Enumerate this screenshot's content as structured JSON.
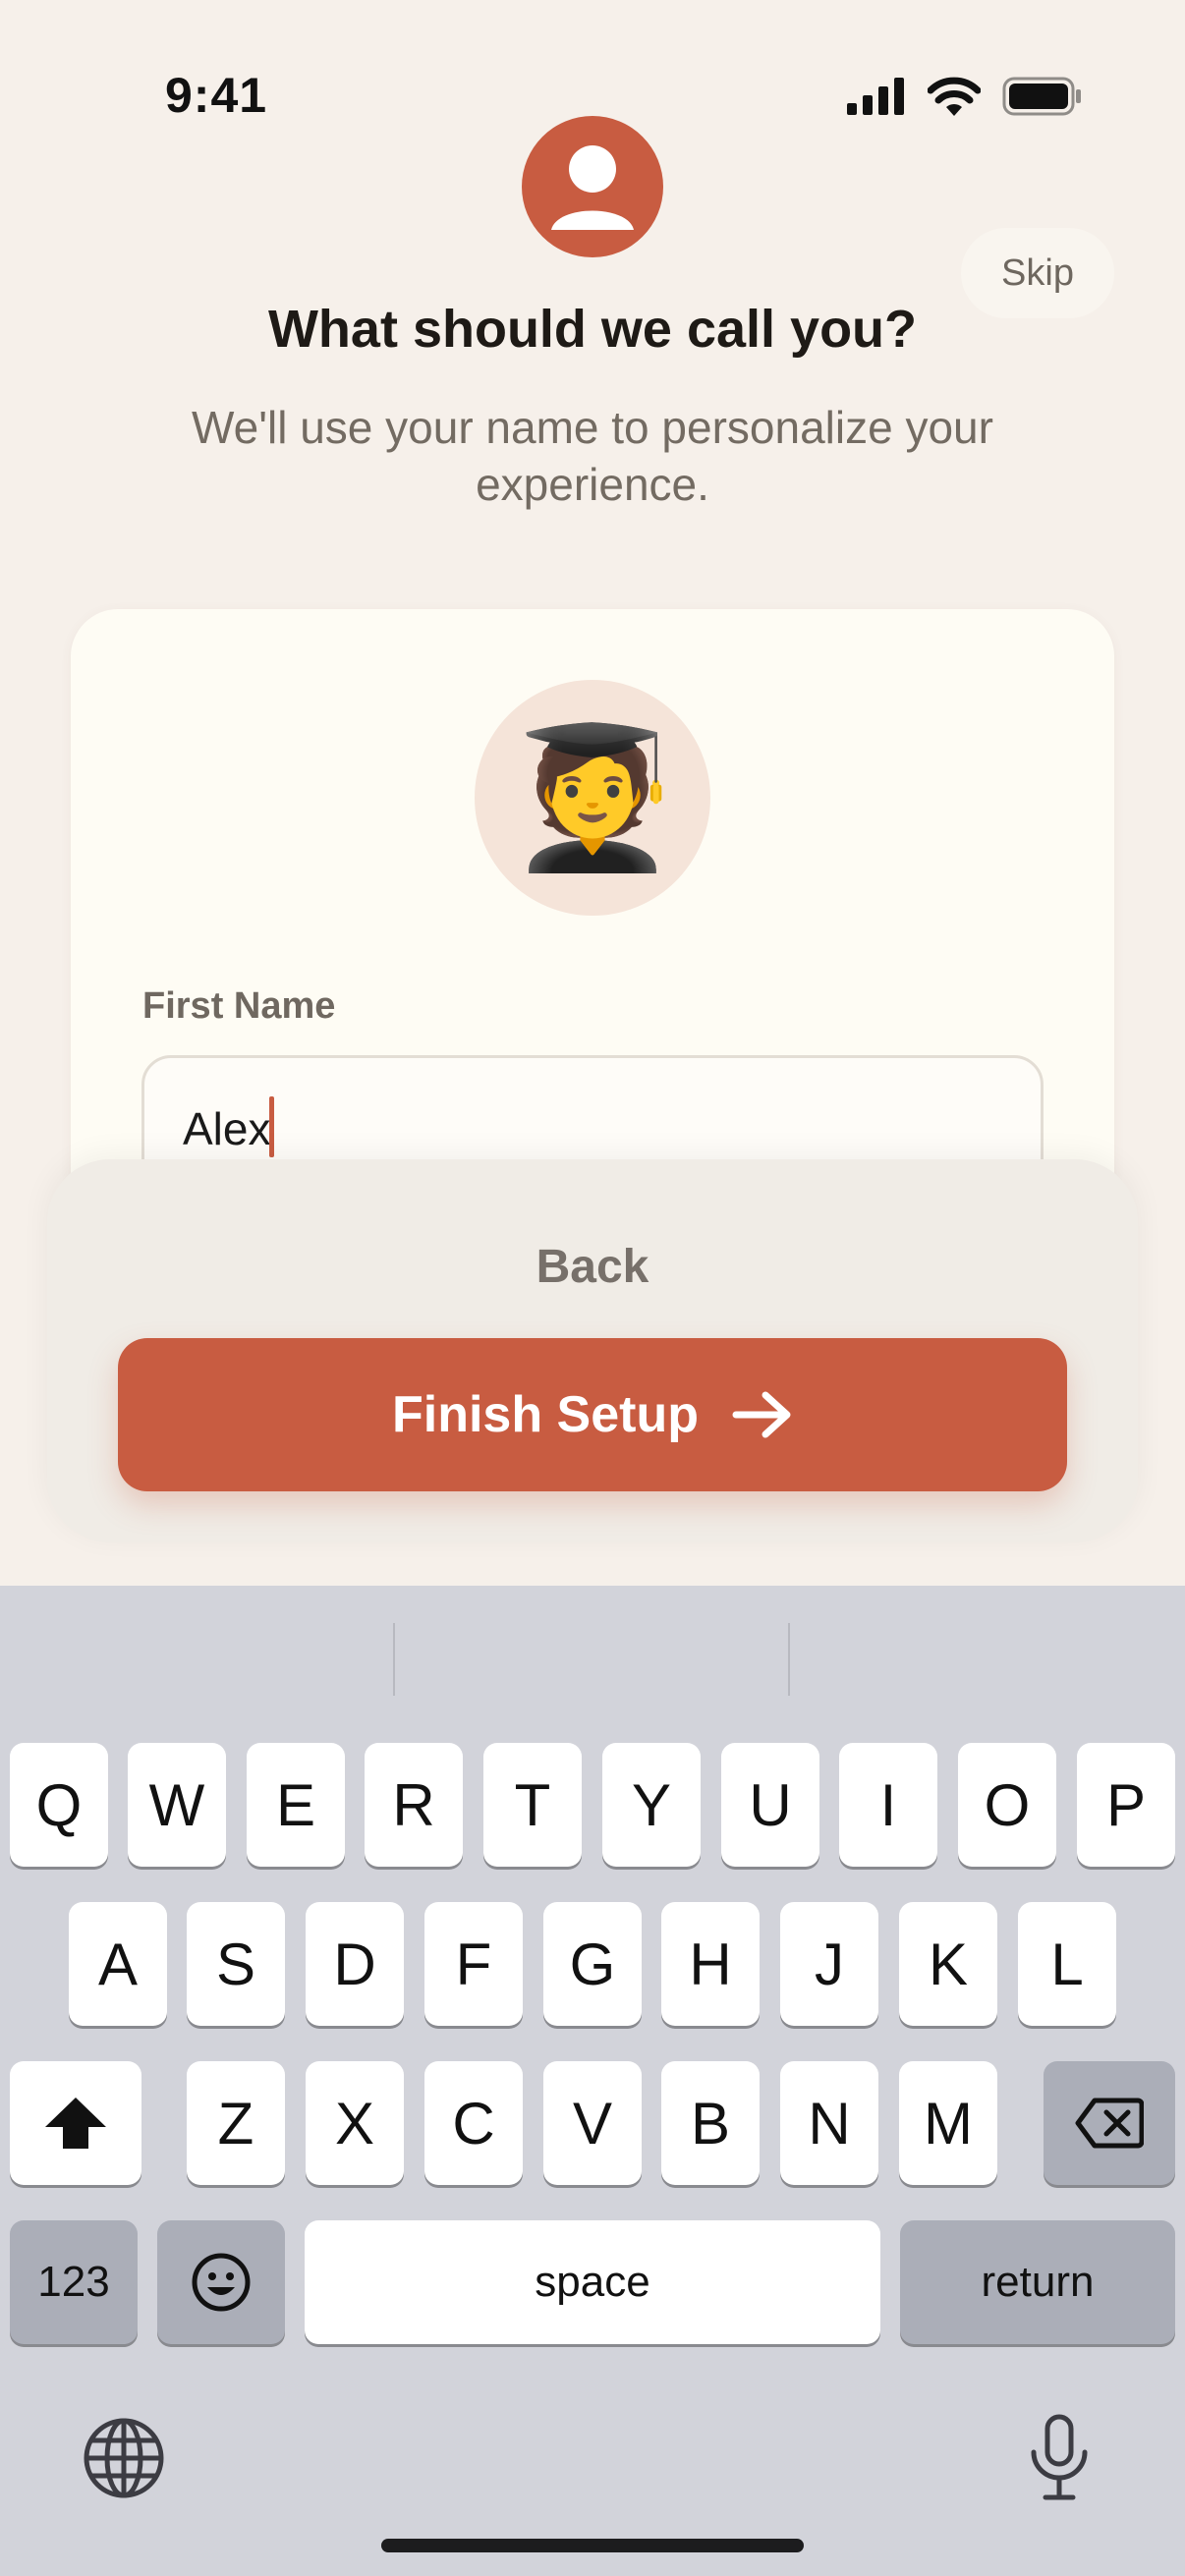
{
  "status_bar": {
    "time": "9:41"
  },
  "header": {
    "skip_label": "Skip",
    "title": "What should we call you?",
    "subtitle": "We'll use your name to personalize your experience."
  },
  "card": {
    "avatar_emoji": "🧑‍🎓",
    "first_name_label": "First Name",
    "first_name_value": "Alex"
  },
  "actions": {
    "back_label": "Back",
    "finish_label": "Finish Setup"
  },
  "keyboard": {
    "row1": [
      "Q",
      "W",
      "E",
      "R",
      "T",
      "Y",
      "U",
      "I",
      "O",
      "P"
    ],
    "row2": [
      "A",
      "S",
      "D",
      "F",
      "G",
      "H",
      "J",
      "K",
      "L"
    ],
    "row3": [
      "Z",
      "X",
      "C",
      "V",
      "B",
      "N",
      "M"
    ],
    "numbers_label": "123",
    "space_label": "space",
    "return_label": "return"
  },
  "colors": {
    "accent": "#c85c41",
    "background": "#f6f0ea",
    "card": "#fefcf4",
    "keyboard": "#d2d3da"
  },
  "icons": [
    "signal-icon",
    "wifi-icon",
    "battery-icon",
    "user-icon",
    "arrow-right-icon",
    "shift-icon",
    "backspace-icon",
    "emoji-icon",
    "globe-icon",
    "microphone-icon"
  ]
}
